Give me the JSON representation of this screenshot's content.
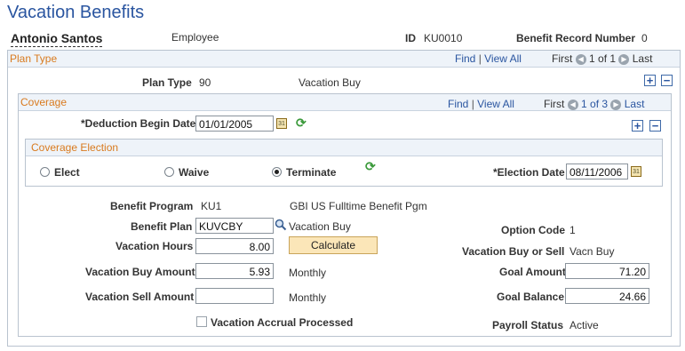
{
  "page": {
    "title": "Vacation Benefits"
  },
  "employee": {
    "name": "Antonio Santos",
    "role": "Employee",
    "id_label": "ID",
    "id_value": "KU0010",
    "benefit_record_label": "Benefit Record Number",
    "benefit_record_value": "0"
  },
  "plan_type_section": {
    "header": "Plan Type",
    "find": "Find",
    "view_all": "View All",
    "first": "First",
    "pager": "1 of 1",
    "last": "Last",
    "plan_type_label": "Plan Type",
    "plan_type_code": "90",
    "plan_type_desc": "Vacation Buy"
  },
  "coverage_section": {
    "header": "Coverage",
    "find": "Find",
    "view_all": "View All",
    "first": "First",
    "pager": "1 of 3",
    "last": "Last",
    "deduction_begin_label": "*Deduction Begin Date",
    "deduction_begin_value": "01/01/2005"
  },
  "coverage_election": {
    "header": "Coverage Election",
    "elect": "Elect",
    "waive": "Waive",
    "terminate": "Terminate",
    "selected": "Terminate",
    "election_date_label": "*Election Date",
    "election_date_value": "08/11/2006"
  },
  "details": {
    "benefit_program_label": "Benefit Program",
    "benefit_program_code": "KU1",
    "benefit_program_desc": "GBI US Fulltime Benefit Pgm",
    "benefit_plan_label": "Benefit Plan",
    "benefit_plan_value": "KUVCBY",
    "benefit_plan_desc": "Vacation Buy",
    "option_code_label": "Option Code",
    "option_code_value": "1",
    "vacation_hours_label": "Vacation Hours",
    "vacation_hours_value": "8.00",
    "calculate_button": "Calculate",
    "buy_or_sell_label": "Vacation Buy or Sell",
    "buy_or_sell_value": "Vacn Buy",
    "buy_amount_label": "Vacation Buy Amount",
    "buy_amount_value": "5.93",
    "buy_amount_freq": "Monthly",
    "goal_amount_label": "Goal Amount",
    "goal_amount_value": "71.20",
    "sell_amount_label": "Vacation Sell Amount",
    "sell_amount_value": "",
    "sell_amount_freq": "Monthly",
    "goal_balance_label": "Goal Balance",
    "goal_balance_value": "24.66",
    "accrual_processed_label": "Vacation Accrual Processed",
    "payroll_status_label": "Payroll Status",
    "payroll_status_value": "Active"
  }
}
